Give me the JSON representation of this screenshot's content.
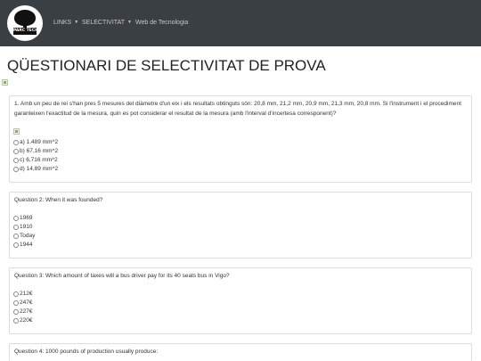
{
  "navbar": {
    "logo_text": "PARC TECH",
    "links_label": "LINKS",
    "selectivitat_label": "SELECTIVITAT",
    "web_label": "Web de Tecnologia",
    "caret": "▼"
  },
  "page": {
    "title": "QÜESTIONARI DE SELECTIVITAT DE PROVA"
  },
  "questions": [
    {
      "text": "1. Amb un peu de rei s'han pres 5 mesures del diàmetre d'un eix i els resultats obtinguts són: 20,8 mm, 21,2 mm, 20,9 mm, 21,3 mm, 20,8 mm. Si l'instrument i el procediment garanteixen l'exactitud de la mesura, quin es pot considerar el resultat de la mesura (amb l'interval d'incertesa corresponent)?",
      "options": [
        "a) 1.489 mm^2",
        "b) 67,16 mm^2",
        "c) 6,716 mm^2",
        "d) 14,89 mm^2"
      ]
    },
    {
      "text": "Question 2: When it was founded?",
      "options": [
        "1969",
        "1910",
        "Today",
        "1944"
      ]
    },
    {
      "text": "Question 3: Which amount of taxes will a bus driver pay for its 40 seats bus in Vigo?",
      "options": [
        "212€",
        "247€",
        "227€",
        "220€"
      ]
    },
    {
      "text": "Question 4: 1000 pounds of production usually produce:",
      "options": []
    }
  ]
}
